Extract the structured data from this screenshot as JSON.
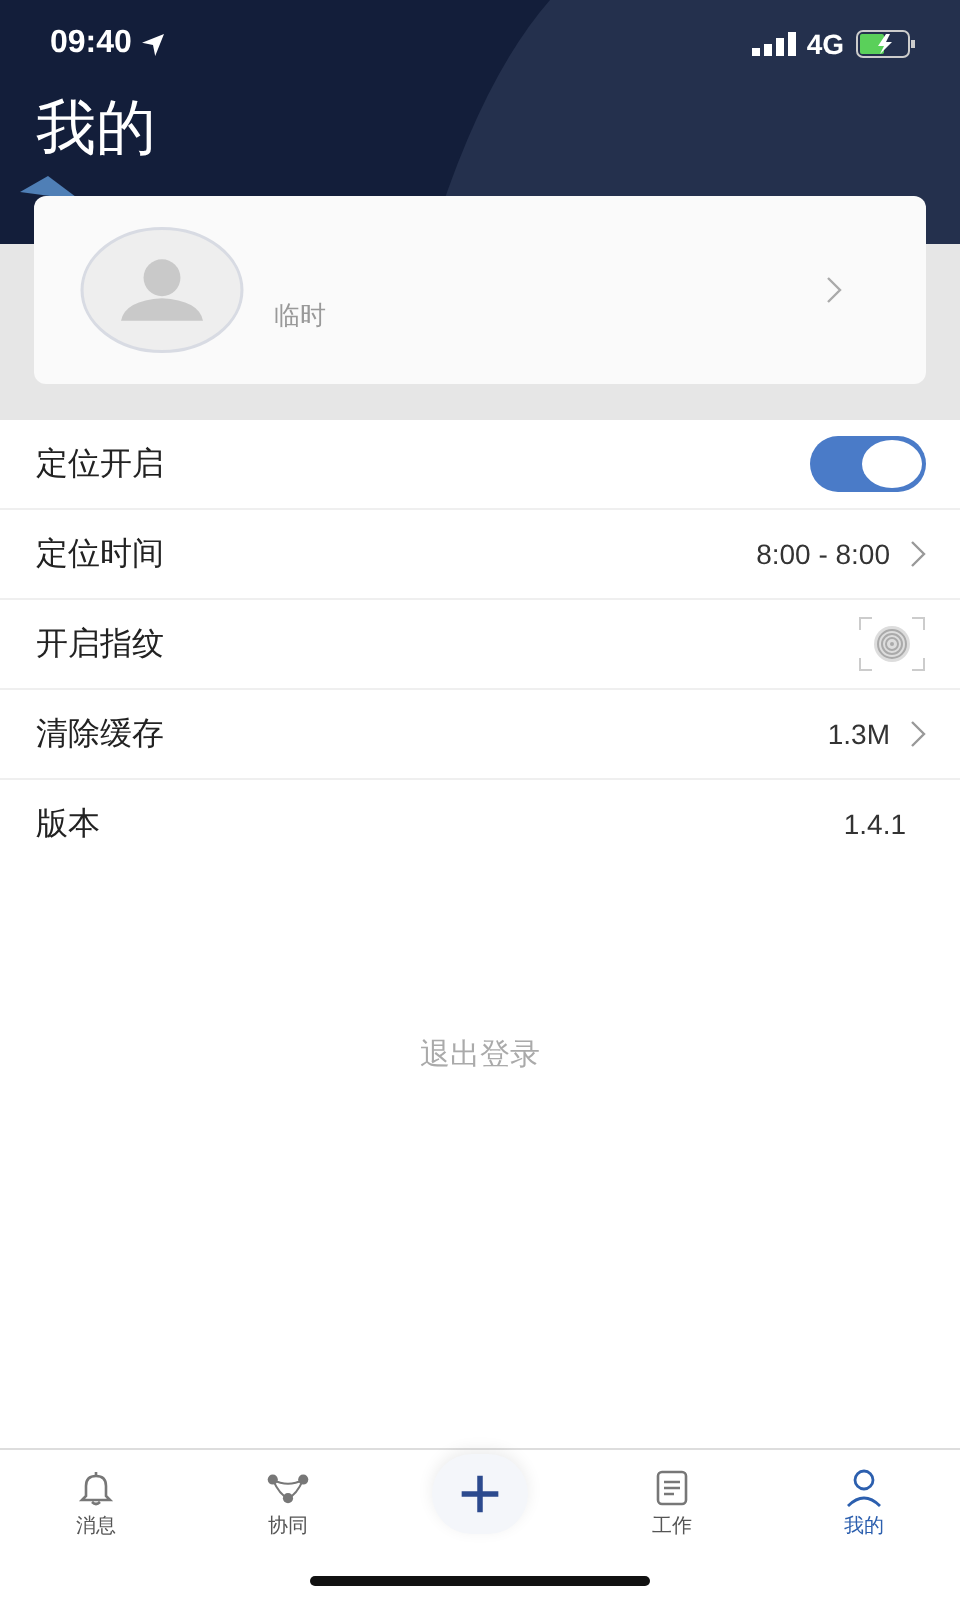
{
  "status_bar": {
    "time": "09:40",
    "network": "4G"
  },
  "header": {
    "title": "我的"
  },
  "profile": {
    "name": "临时"
  },
  "settings": [
    {
      "kind": "toggle",
      "label": "定位开启",
      "on": true
    },
    {
      "kind": "link",
      "label": "定位时间",
      "value": "8:00 - 8:00"
    },
    {
      "kind": "fingerprint",
      "label": "开启指纹"
    },
    {
      "kind": "link",
      "label": "清除缓存",
      "value": "1.3M"
    },
    {
      "kind": "value",
      "label": "版本",
      "value": "1.4.1"
    }
  ],
  "logout": "退出登录",
  "tab_bar": [
    {
      "kind": "bell",
      "label": "消息",
      "selected": false
    },
    {
      "kind": "network",
      "label": "协同",
      "selected": false
    },
    {
      "kind": "add",
      "selected": false
    },
    {
      "kind": "list",
      "label": "工作",
      "selected": false
    },
    {
      "kind": "person",
      "label": "我的",
      "selected": true
    }
  ]
}
